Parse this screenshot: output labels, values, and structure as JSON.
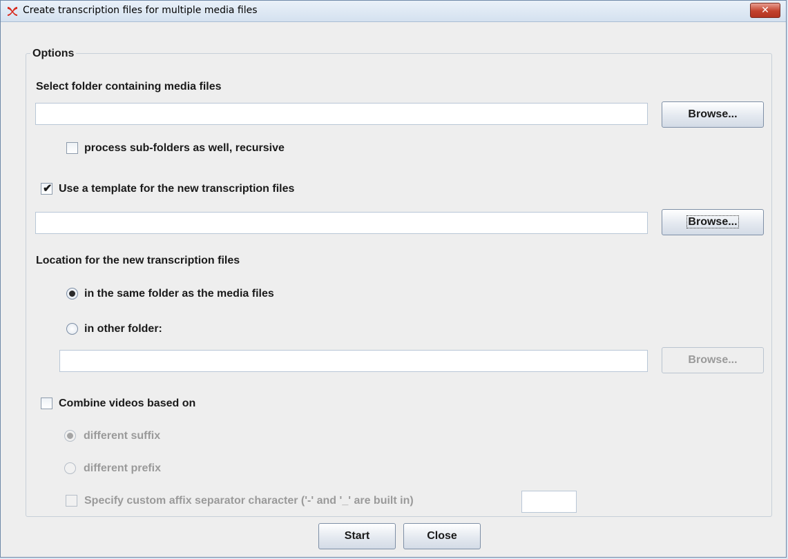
{
  "window": {
    "title": "Create transcription files for multiple media files",
    "close_glyph": "✕",
    "app_icon": "elan-logo-icon"
  },
  "options": {
    "legend": "Options",
    "media_folder": {
      "label": "Select folder containing media files",
      "value": "",
      "browse_label": "Browse...",
      "recursive_label": "process sub-folders as well, recursive",
      "recursive_checked": false
    },
    "template": {
      "label": "Use a template for the new transcription files",
      "checked": true,
      "check_glyph": "✔",
      "value": "",
      "browse_label": "Browse..."
    },
    "location": {
      "label": "Location for the new transcription files",
      "same_folder_label": "in the same folder as the media files",
      "same_folder_selected": true,
      "other_folder_label": "in other folder:",
      "other_folder_value": "",
      "browse_label": "Browse..."
    },
    "combine": {
      "label": "Combine videos based on",
      "checked": false,
      "suffix_label": "different suffix",
      "suffix_selected": true,
      "prefix_label": "different prefix",
      "custom_separator_label": "Specify custom affix separator character ('-' and '_' are built in)",
      "custom_separator_value": ""
    }
  },
  "footer": {
    "start_label": "Start",
    "close_label": "Close"
  },
  "colors": {
    "disabled_text": "#9a9a9a",
    "close_button": "#c2422d"
  }
}
